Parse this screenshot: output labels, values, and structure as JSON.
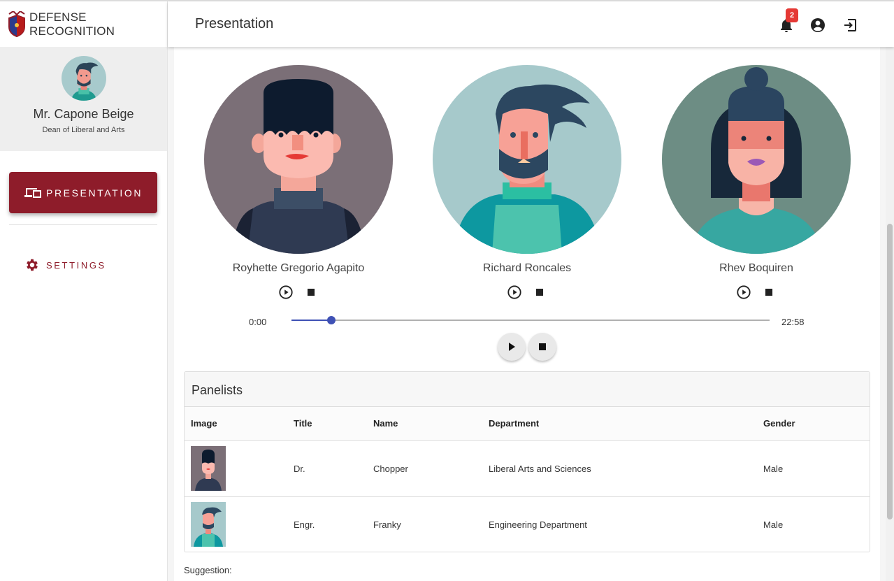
{
  "brand": {
    "line1": "DEFENSE",
    "line2": "RECOGNITION"
  },
  "profile": {
    "name": "Mr. Capone Beige",
    "role": "Dean of Liberal and Arts"
  },
  "nav": {
    "presentation": "PRESENTATION",
    "settings": "SETTINGS"
  },
  "header": {
    "title": "Presentation",
    "notification_count": "2"
  },
  "speakers": [
    {
      "name": "Royhette Gregorio Agapito"
    },
    {
      "name": "Richard Roncales"
    },
    {
      "name": "Rhev Boquiren"
    }
  ],
  "player": {
    "current_time": "0:00",
    "total_time": "22:58",
    "progress": 0.084
  },
  "panelists": {
    "title": "Panelists",
    "columns": [
      "Image",
      "Title",
      "Name",
      "Department",
      "Gender"
    ],
    "rows": [
      {
        "title": "Dr.",
        "name": "Chopper",
        "department": "Liberal Arts and Sciences",
        "gender": "Male"
      },
      {
        "title": "Engr.",
        "name": "Franky",
        "department": "Engineering Department",
        "gender": "Male"
      }
    ]
  },
  "suggestion_label": "Suggestion:",
  "colors": {
    "accent": "#8e1c2a",
    "slider": "#3f51b5",
    "badge": "#e53935"
  }
}
